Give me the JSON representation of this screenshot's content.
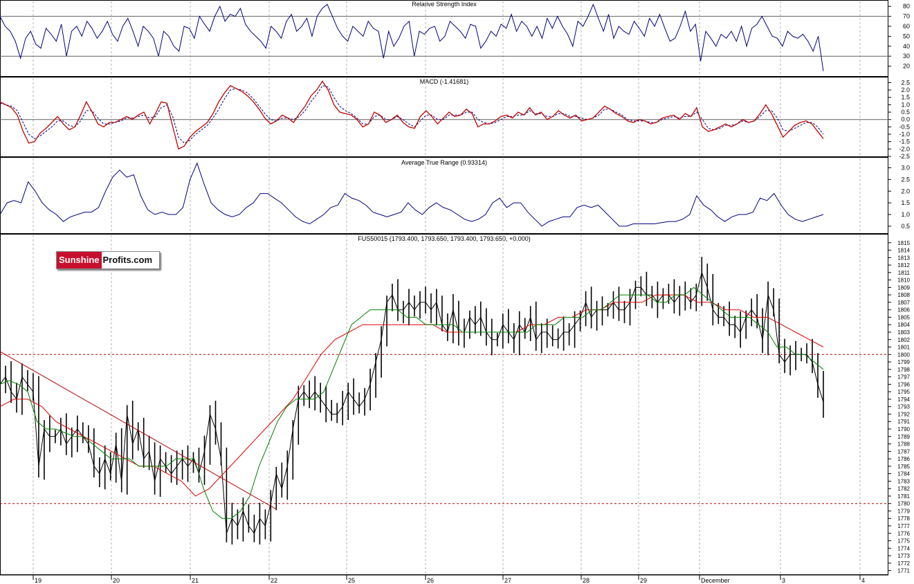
{
  "logo": {
    "part1": "Sunshine",
    "part2": "Profits.com"
  },
  "colors": {
    "rsi": "#000080",
    "macd": "#c00000",
    "signal": "#000080",
    "atr": "#000080",
    "price": "#000000",
    "ma_short": "#008000",
    "ma_long": "#e00000",
    "trendline": "#b00000",
    "hline": "#b00000",
    "grid": "#b0b0b0"
  },
  "chart_data": [
    {
      "type": "line",
      "title": "Relative Strength Index",
      "ylim": [
        10,
        85
      ],
      "yticks": [
        20,
        30,
        40,
        50,
        60,
        70,
        80
      ],
      "reference_lines": [
        30,
        70
      ],
      "series": [
        {
          "values": [
            70,
            60,
            55,
            45,
            28,
            48,
            55,
            42,
            38,
            58,
            52,
            45,
            62,
            30,
            55,
            60,
            50,
            65,
            58,
            48,
            55,
            65,
            52,
            45,
            60,
            68,
            55,
            40,
            60,
            55,
            48,
            30,
            55,
            50,
            40,
            35,
            60,
            58,
            48,
            70,
            62,
            55,
            70,
            80,
            65,
            72,
            70,
            78,
            62,
            55,
            50,
            45,
            38,
            60,
            55,
            48,
            65,
            72,
            55,
            60,
            68,
            50,
            70,
            78,
            82,
            70,
            58,
            50,
            45,
            60,
            55,
            50,
            65,
            58,
            55,
            28,
            55,
            40,
            48,
            60,
            65,
            30,
            55,
            52,
            58,
            60,
            45,
            50,
            65,
            60,
            55,
            48,
            62,
            60,
            38,
            45,
            55,
            50,
            62,
            58,
            72,
            55,
            65,
            60,
            50,
            60,
            48,
            68,
            58,
            70,
            60,
            52,
            40,
            65,
            60,
            70,
            82,
            68,
            55,
            72,
            48,
            60,
            55,
            52,
            65,
            58,
            50,
            68,
            60,
            72,
            58,
            45,
            48,
            60,
            75,
            55,
            62,
            25,
            55,
            48,
            40,
            52,
            48,
            55,
            45,
            60,
            40,
            58,
            62,
            70,
            60,
            50,
            48,
            40,
            55,
            50,
            48,
            52,
            45,
            35,
            50,
            15
          ]
        }
      ]
    },
    {
      "type": "line",
      "title": "MACD (-1.41681)",
      "ylim": [
        -2.5,
        2.8
      ],
      "yticks": [
        -2.5,
        -2.0,
        -1.5,
        -1.0,
        -0.5,
        0.0,
        0.5,
        1.0,
        1.5,
        2.0,
        2.5
      ],
      "reference_lines": [
        0
      ],
      "series": [
        {
          "name": "MACD",
          "values": [
            1.2,
            1.0,
            0.8,
            0.3,
            -0.8,
            -1.6,
            -1.5,
            -0.9,
            -0.6,
            -0.2,
            0.2,
            -0.3,
            -0.7,
            -0.5,
            0.3,
            1.2,
            0.5,
            -0.3,
            -0.5,
            -0.2,
            -0.2,
            0.0,
            0.2,
            0.0,
            0.3,
            0.5,
            -0.3,
            0.4,
            1.2,
            1.1,
            -0.5,
            -2.0,
            -1.8,
            -1.2,
            -0.8,
            -0.5,
            -0.2,
            0.4,
            1.2,
            1.8,
            2.3,
            2.1,
            1.9,
            1.6,
            1.2,
            0.7,
            0.1,
            -0.3,
            -0.1,
            0.3,
            0.1,
            -0.2,
            0.4,
            0.9,
            1.6,
            2.0,
            2.6,
            2.0,
            1.0,
            0.5,
            0.4,
            0.3,
            0.0,
            -0.5,
            -0.3,
            0.5,
            0.3,
            -0.2,
            0.0,
            0.3,
            -0.2,
            -0.5,
            -0.6,
            0.2,
            0.6,
            0.2,
            -0.3,
            0.1,
            0.5,
            0.2,
            0.3,
            0.7,
            0.4,
            -0.5,
            -0.3,
            -0.3,
            -0.1,
            0.2,
            0.3,
            0.1,
            0.5,
            0.3,
            0.8,
            0.3,
            0.5,
            0.0,
            0.2,
            0.6,
            0.3,
            0.1,
            0.3,
            -0.1,
            0.0,
            0.1,
            0.5,
            0.9,
            0.7,
            0.4,
            0.2,
            -0.1,
            -0.2,
            0.0,
            -0.1,
            -0.3,
            -0.2,
            0.1,
            0.2,
            0.3,
            0.0,
            0.4,
            0.2,
            0.8,
            -0.5,
            -0.8,
            -0.7,
            -0.5,
            -0.3,
            -0.5,
            -0.3,
            0.0,
            -0.2,
            -0.1,
            0.4,
            1.0,
            0.4,
            -0.4,
            -1.2,
            -0.8,
            -0.4,
            -0.2,
            -0.1,
            -0.3,
            -0.8,
            -1.3
          ]
        },
        {
          "name": "Signal",
          "values": [
            1.1,
            1.0,
            0.9,
            0.6,
            -0.2,
            -1.0,
            -1.3,
            -1.1,
            -0.8,
            -0.5,
            -0.1,
            -0.1,
            -0.4,
            -0.5,
            -0.1,
            0.6,
            0.6,
            0.1,
            -0.3,
            -0.3,
            -0.2,
            -0.1,
            0.1,
            0.1,
            0.2,
            0.3,
            0.1,
            0.2,
            0.8,
            1.0,
            0.2,
            -1.2,
            -1.6,
            -1.4,
            -1.0,
            -0.7,
            -0.4,
            0.1,
            0.7,
            1.4,
            2.0,
            2.1,
            2.0,
            1.8,
            1.4,
            0.9,
            0.4,
            0.0,
            -0.1,
            0.1,
            0.1,
            0.0,
            0.2,
            0.6,
            1.2,
            1.7,
            2.3,
            2.2,
            1.5,
            0.9,
            0.6,
            0.4,
            0.1,
            -0.3,
            -0.3,
            0.2,
            0.3,
            0.0,
            0.0,
            0.2,
            0.0,
            -0.3,
            -0.5,
            -0.1,
            0.3,
            0.3,
            0.0,
            0.0,
            0.3,
            0.3,
            0.3,
            0.5,
            0.5,
            0.0,
            -0.2,
            -0.3,
            -0.2,
            0.0,
            0.2,
            0.2,
            0.3,
            0.3,
            0.6,
            0.4,
            0.4,
            0.2,
            0.2,
            0.4,
            0.4,
            0.2,
            0.2,
            0.1,
            0.0,
            0.1,
            0.3,
            0.7,
            0.7,
            0.5,
            0.3,
            0.0,
            -0.1,
            -0.1,
            -0.1,
            -0.2,
            -0.2,
            0.0,
            0.1,
            0.2,
            0.1,
            0.2,
            0.2,
            0.5,
            0.0,
            -0.6,
            -0.7,
            -0.6,
            -0.4,
            -0.4,
            -0.3,
            -0.1,
            -0.2,
            -0.1,
            0.2,
            0.6,
            0.6,
            0.1,
            -0.7,
            -0.8,
            -0.6,
            -0.4,
            -0.2,
            -0.2,
            -0.5,
            -1.0
          ]
        }
      ]
    },
    {
      "type": "line",
      "title": "Average True Range (0.93314)",
      "ylim": [
        0.2,
        3.4
      ],
      "yticks": [
        0.5,
        1.0,
        1.5,
        2.0,
        2.5,
        3.0
      ],
      "series": [
        {
          "values": [
            1.0,
            1.5,
            1.6,
            1.5,
            2.4,
            2.0,
            1.5,
            1.2,
            1.0,
            0.7,
            0.9,
            1.0,
            1.1,
            1.1,
            1.3,
            2.0,
            2.6,
            2.9,
            2.6,
            2.7,
            1.8,
            1.2,
            1.0,
            1.1,
            1.0,
            1.0,
            1.3,
            2.5,
            3.2,
            2.3,
            1.5,
            1.2,
            1.0,
            0.9,
            1.0,
            1.3,
            1.5,
            1.9,
            1.9,
            1.7,
            1.5,
            1.2,
            0.9,
            0.7,
            0.6,
            0.8,
            1.0,
            1.3,
            1.4,
            1.9,
            1.7,
            1.6,
            1.4,
            1.1,
            1.0,
            0.9,
            1.0,
            1.1,
            1.5,
            1.2,
            1.0,
            1.3,
            1.5,
            1.3,
            1.2,
            1.0,
            0.8,
            0.7,
            0.8,
            1.0,
            1.5,
            1.7,
            1.3,
            1.5,
            1.5,
            1.1,
            0.8,
            0.5,
            0.7,
            0.8,
            0.9,
            0.9,
            1.3,
            1.4,
            1.3,
            1.4,
            1.1,
            0.8,
            0.5,
            0.5,
            0.6,
            0.6,
            0.6,
            0.6,
            0.65,
            0.7,
            0.7,
            0.8,
            1.0,
            1.8,
            1.4,
            1.2,
            0.9,
            0.7,
            0.9,
            1.0,
            1.0,
            1.1,
            1.7,
            1.6,
            1.9,
            1.4,
            1.0,
            0.8,
            0.7,
            0.8,
            0.9,
            1.0
          ]
        }
      ]
    },
    {
      "type": "line",
      "title": "FUS50015 (1793.400, 1793.650, 1793.400, 1793.650, +0.000)",
      "ylim": [
        1770.5,
        1816
      ],
      "yticks": [
        1771,
        1772,
        1773,
        1774,
        1775,
        1776,
        1777,
        1778,
        1779,
        1780,
        1781,
        1782,
        1783,
        1784,
        1785,
        1786,
        1787,
        1788,
        1789,
        1790,
        1791,
        1792,
        1793,
        1794,
        1795,
        1796,
        1797,
        1798,
        1799,
        1800,
        1801,
        1802,
        1803,
        1804,
        1805,
        1806,
        1807,
        1808,
        1809,
        1810,
        1811,
        1812,
        1813,
        1814,
        1815
      ],
      "reference_lines": [
        1800,
        1780
      ],
      "x_ticks": [
        "19",
        "20",
        "21",
        "22",
        "25",
        "26",
        "27",
        "28",
        "29",
        "December",
        "3",
        "4"
      ],
      "trendline": {
        "from": [
          0.0,
          1800.4
        ],
        "to": [
          400.0,
          1779.2
        ]
      },
      "series": [
        {
          "name": "Price",
          "values": [
            1796,
            1797,
            1795,
            1794,
            1797,
            1796,
            1795,
            1785,
            1790,
            1789,
            1789,
            1790,
            1788,
            1789,
            1790,
            1789,
            1788,
            1785,
            1784,
            1786,
            1784,
            1788,
            1783,
            1792,
            1788,
            1790,
            1786,
            1787,
            1783,
            1786,
            1785,
            1784,
            1785,
            1786,
            1785,
            1786,
            1784,
            1787,
            1792,
            1790,
            1786,
            1776,
            1778,
            1777,
            1779,
            1777,
            1776,
            1778,
            1777,
            1780,
            1784,
            1782,
            1785,
            1790,
            1794,
            1795,
            1794,
            1795,
            1794,
            1793,
            1792,
            1792,
            1793,
            1795,
            1794,
            1793,
            1794,
            1796,
            1799,
            1802,
            1807,
            1808,
            1806,
            1806,
            1807,
            1806,
            1807,
            1807,
            1806,
            1807,
            1804,
            1803,
            1806,
            1803,
            1803,
            1805,
            1804,
            1805,
            1803,
            1802,
            1802,
            1804,
            1803,
            1802,
            1804,
            1803,
            1805,
            1802,
            1803,
            1803,
            1802,
            1802,
            1803,
            1803,
            1804,
            1805,
            1807,
            1805,
            1806,
            1806,
            1806,
            1807,
            1806,
            1806,
            1807,
            1809,
            1809,
            1808,
            1808,
            1807,
            1808,
            1808,
            1807,
            1808,
            1808,
            1807,
            1808,
            1811,
            1809,
            1806,
            1805,
            1805,
            1804,
            1804,
            1803,
            1805,
            1806,
            1805,
            1802,
            1808,
            1806,
            1800,
            1799,
            1800,
            1800,
            1800,
            1800,
            1799,
            1796,
            1793.6
          ]
        },
        {
          "name": "MA short",
          "values": [
            1796,
            1796.5,
            1796,
            1795,
            1791,
            1790,
            1790,
            1789.5,
            1789,
            1789,
            1788,
            1787,
            1786,
            1786,
            1786,
            1785,
            1785,
            1785,
            1785,
            1786,
            1786,
            1786,
            1782,
            1779,
            1778,
            1778,
            1779,
            1781,
            1785,
            1788,
            1791,
            1793,
            1794,
            1794,
            1794,
            1795,
            1798,
            1801,
            1804,
            1805,
            1806,
            1806,
            1806,
            1806,
            1805,
            1805,
            1804,
            1804,
            1804,
            1804,
            1803,
            1803,
            1803,
            1803,
            1803,
            1803,
            1803,
            1803,
            1804,
            1804,
            1804,
            1805,
            1805,
            1805,
            1806,
            1806,
            1807,
            1808,
            1808,
            1808,
            1808,
            1807,
            1807,
            1808,
            1808,
            1809,
            1808,
            1807,
            1806,
            1805,
            1805,
            1805,
            1804,
            1803,
            1801,
            1801,
            1800,
            1800,
            1799,
            1798
          ]
        },
        {
          "name": "MA long",
          "values": [
            1793,
            1794,
            1794,
            1793,
            1791,
            1790,
            1789,
            1788,
            1787,
            1786,
            1785,
            1785,
            1784,
            1783,
            1781,
            1782,
            1784,
            1786,
            1788,
            1790,
            1792,
            1794,
            1797,
            1800,
            1802,
            1803,
            1804,
            1804,
            1804,
            1804,
            1804,
            1804,
            1803,
            1803,
            1803,
            1803,
            1803,
            1803,
            1804,
            1804,
            1805,
            1805,
            1806,
            1806,
            1807,
            1807,
            1807,
            1808,
            1808,
            1808,
            1807,
            1807,
            1806,
            1806,
            1805,
            1805,
            1804,
            1803,
            1802,
            1801
          ]
        }
      ]
    }
  ]
}
